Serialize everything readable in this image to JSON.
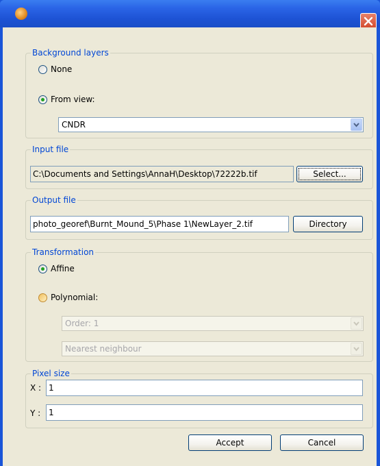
{
  "window": {
    "icon": "app-globe-icon",
    "close_icon": "close-icon"
  },
  "background_layers": {
    "title": "Background layers",
    "none_label": "None",
    "from_view_label": "From view:",
    "selected": "from_view",
    "view_value": "CNDR"
  },
  "input_file": {
    "title": "Input file",
    "path": "C:\\Documents and Settings\\AnnaH\\Desktop\\72222b.tif",
    "select_label": "Select..."
  },
  "output_file": {
    "title": "Output file",
    "path": "photo_georef\\Burnt_Mound_5\\Phase 1\\NewLayer_2.tif",
    "directory_label": "Directory"
  },
  "transformation": {
    "title": "Transformation",
    "affine_label": "Affine",
    "polynomial_label": "Polynomial:",
    "selected": "affine",
    "order_value": "Order: 1",
    "interpolation_value": "Nearest neighbour"
  },
  "pixel_size": {
    "title": "Pixel size",
    "x_label": "X :",
    "x_value": "1",
    "y_label": "Y :",
    "y_value": "1"
  },
  "footer": {
    "accept_label": "Accept",
    "cancel_label": "Cancel"
  },
  "colors": {
    "title_bar": "#2a64e6",
    "group_title": "#0046d5",
    "dialog_bg": "#ece9d8"
  }
}
